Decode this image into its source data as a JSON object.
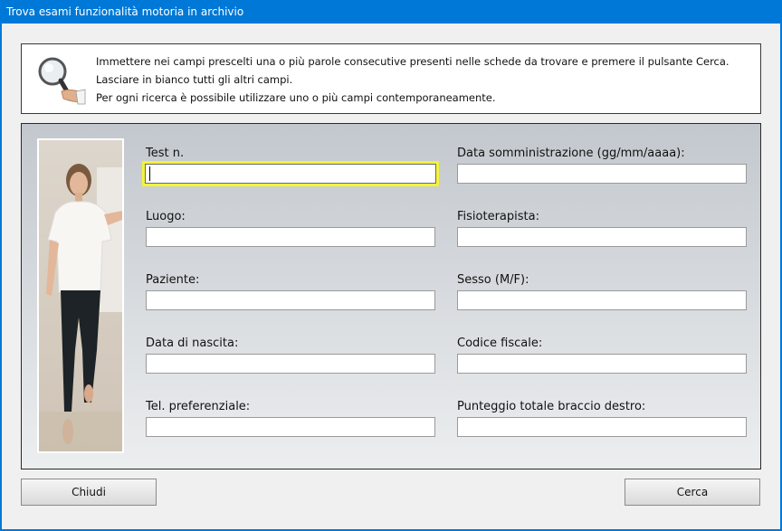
{
  "window": {
    "title": "Trova esami funzionalità motoria in archivio"
  },
  "info": {
    "lines": [
      "Immettere nei campi prescelti una o più parole consecutive presenti nelle schede da trovare e premere il pulsante Cerca.",
      "Lasciare in bianco tutti gli altri campi.",
      "Per ogni ricerca è possibile utilizzare uno o più campi contemporaneamente."
    ],
    "icon": "magnifier-hand-icon"
  },
  "fields": {
    "test_n": {
      "label": "Test n.",
      "value": ""
    },
    "data_somministrazione": {
      "label": "Data somministrazione (gg/mm/aaaa):",
      "value": ""
    },
    "luogo": {
      "label": "Luogo:",
      "value": ""
    },
    "fisioterapista": {
      "label": "Fisioterapista:",
      "value": ""
    },
    "paziente": {
      "label": "Paziente:",
      "value": ""
    },
    "sesso": {
      "label": "Sesso (M/F):",
      "value": ""
    },
    "data_nascita": {
      "label": "Data di nascita:",
      "value": ""
    },
    "codice_fiscale": {
      "label": "Codice fiscale:",
      "value": ""
    },
    "tel": {
      "label": "Tel. preferenziale:",
      "value": ""
    },
    "punteggio": {
      "label": "Punteggio totale braccio destro:",
      "value": ""
    }
  },
  "buttons": {
    "close": "Chiudi",
    "search": "Cerca"
  },
  "colors": {
    "titlebar": "#0078d7",
    "focus_ring": "#f3f33a"
  }
}
